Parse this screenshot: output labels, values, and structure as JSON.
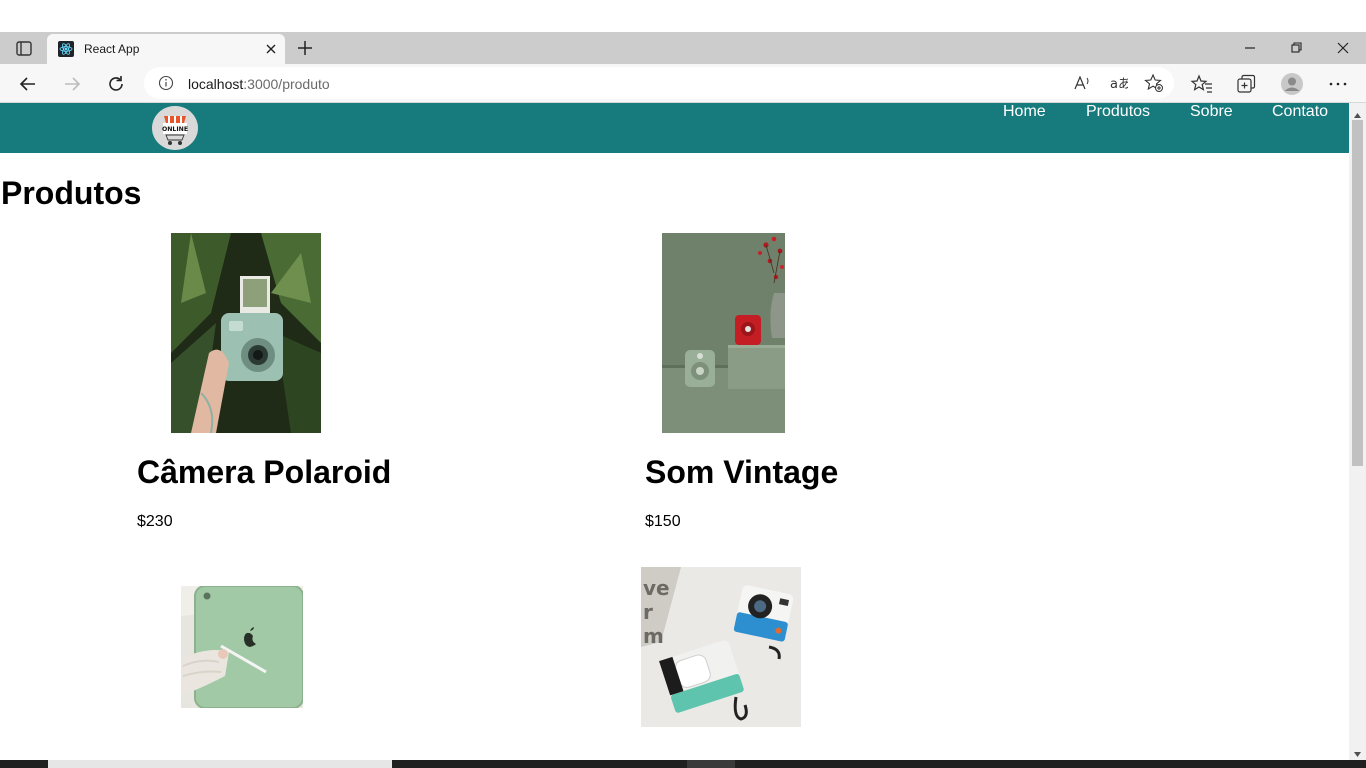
{
  "browser": {
    "tab_title": "React App",
    "url_host": "localhost",
    "url_path": ":3000/produto"
  },
  "site": {
    "logo_text": "ONLINE",
    "nav": [
      {
        "label": "Home"
      },
      {
        "label": "Produtos"
      },
      {
        "label": "Sobre"
      },
      {
        "label": "Contato"
      }
    ],
    "header_color": "#177b7d"
  },
  "page": {
    "title": "Produtos"
  },
  "products": [
    {
      "name": "Câmera Polaroid",
      "price": "$230",
      "image": "polaroid-camera-photo"
    },
    {
      "name": "Som Vintage",
      "price": "$150",
      "image": "vintage-speaker-photo"
    },
    {
      "image": "green-tablet-photo"
    },
    {
      "image": "camera-airpods-case-photo"
    }
  ]
}
